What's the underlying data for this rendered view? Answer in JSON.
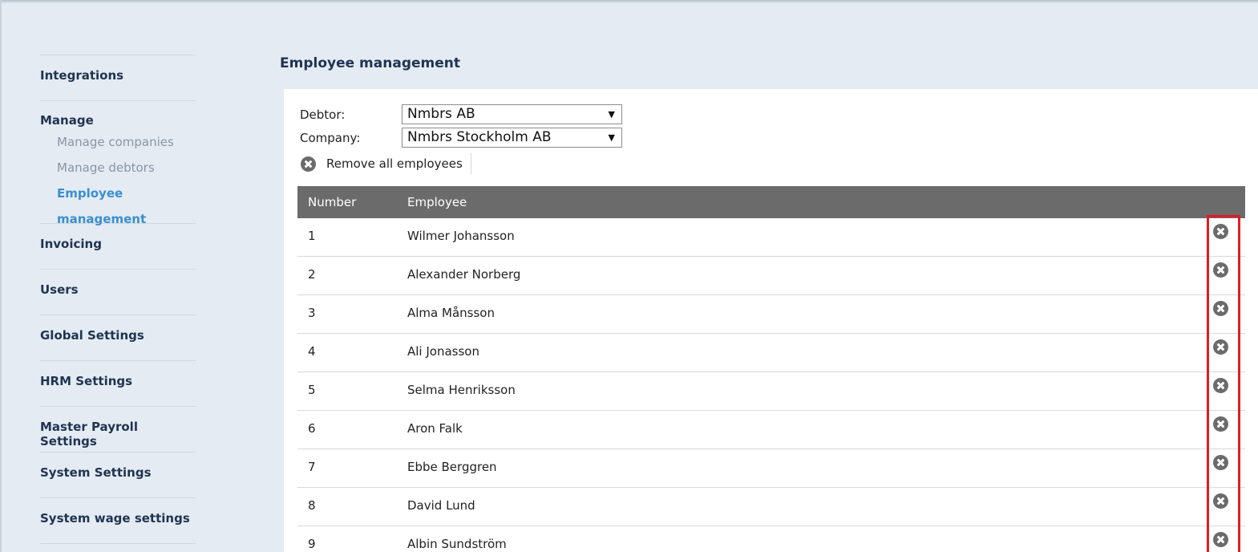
{
  "sidebar": {
    "integrations": "Integrations",
    "manage": "Manage",
    "manage_items": [
      "Manage companies",
      "Manage debtors",
      "Employee management"
    ],
    "invoicing": "Invoicing",
    "users": "Users",
    "global_settings": "Global Settings",
    "hrm_settings": "HRM Settings",
    "master_payroll_settings": "Master Payroll Settings",
    "system_settings": "System Settings",
    "system_wage_settings": "System wage settings"
  },
  "page": {
    "title": "Employee management"
  },
  "form": {
    "debtor_label": "Debtor:",
    "debtor_value": "Nmbrs AB",
    "company_label": "Company:",
    "company_value": "Nmbrs Stockholm AB",
    "remove_all_label": "Remove all employees"
  },
  "table": {
    "headers": [
      "Number",
      "Employee"
    ],
    "rows": [
      {
        "number": "1",
        "employee": "Wilmer Johansson"
      },
      {
        "number": "2",
        "employee": "Alexander Norberg"
      },
      {
        "number": "3",
        "employee": "Alma Månsson"
      },
      {
        "number": "4",
        "employee": "Ali Jonasson"
      },
      {
        "number": "5",
        "employee": "Selma Henriksson"
      },
      {
        "number": "6",
        "employee": "Aron Falk"
      },
      {
        "number": "7",
        "employee": "Ebbe Berggren"
      },
      {
        "number": "8",
        "employee": "David Lund"
      },
      {
        "number": "9",
        "employee": "Albin Sundström"
      }
    ]
  },
  "icons": {
    "delete": "close-circle-icon",
    "dropdown": "dropdown-arrow-icon"
  },
  "colors": {
    "accent": "#3a8fd0",
    "table_header": "#6b6b6b",
    "highlight": "#e21b25"
  }
}
